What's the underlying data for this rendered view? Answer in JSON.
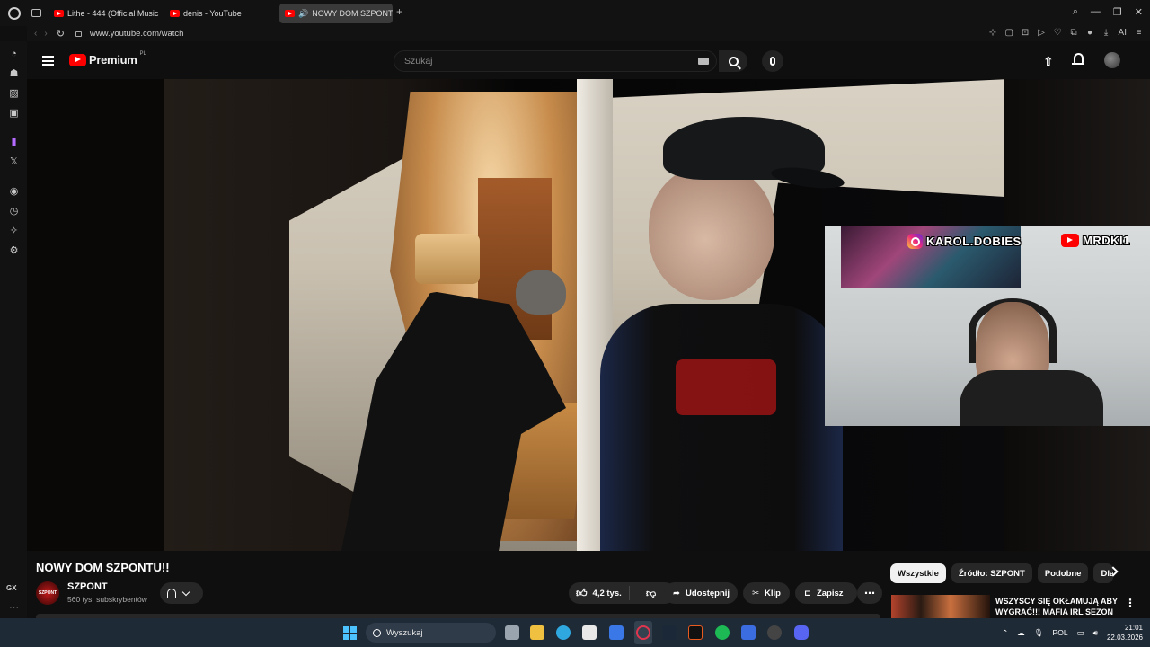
{
  "browser": {
    "tabs": [
      {
        "label": "Lithe - 444 (Official Music"
      },
      {
        "label": "denis - YouTube"
      },
      {
        "label": "NOWY DOM SZPONTU"
      }
    ],
    "url": "www.youtube.com/watch",
    "ai_label": "AI",
    "sidebar_gx_label": "GX"
  },
  "youtube": {
    "logo_text": "Premium",
    "region": "PL",
    "search_placeholder": "Szukaj"
  },
  "overlay": {
    "instagram_handle": "KAROL.DOBIES",
    "youtube_handle": "MRDKI1"
  },
  "video": {
    "title": "NOWY DOM SZPONTU!!",
    "channel_name": "SZPONT",
    "channel_avatar_text": "SZPONT",
    "subscribers": "560 tys. subskrybentów",
    "likes": "4,2 tys.",
    "share_label": "Udostępnij",
    "clip_label": "Klip",
    "save_label": "Zapisz"
  },
  "recommendations": {
    "chips": [
      {
        "label": "Wszystkie",
        "active": true
      },
      {
        "label": "Źródło: SZPONT",
        "active": false
      },
      {
        "label": "Podobne",
        "active": false
      },
      {
        "label": "Dla",
        "active": false
      }
    ],
    "first_video_title": "WSZYSCY SIĘ OKŁAMUJĄ ABY WYGRAĆ!!! MAFIA IRL SEZON ..."
  },
  "taskbar": {
    "search_label": "Wyszukaj",
    "language": "POL",
    "time": "21:01",
    "date": "22.03.2026"
  },
  "colors": {
    "yt_red": "#ff0000",
    "taskbar": "#1f2a37",
    "win_blue": "#4cc2ff"
  }
}
